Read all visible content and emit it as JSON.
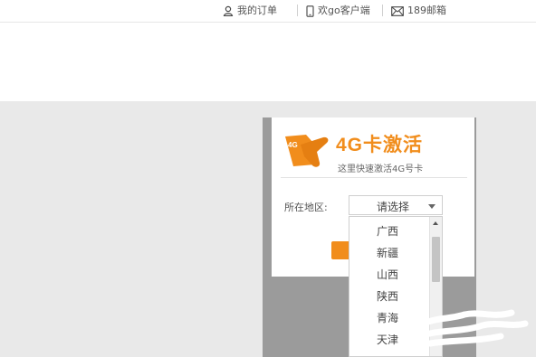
{
  "header": {
    "links": [
      {
        "icon": "user-icon",
        "label": "我的订单"
      },
      {
        "icon": "phone-icon",
        "label": "欢go客户端"
      },
      {
        "icon": "mail-icon",
        "label": "189邮箱"
      }
    ]
  },
  "activation_card": {
    "title": "4G卡激活",
    "subtitle": "这里快速激活4G号卡",
    "badge": "4G",
    "accent_color": "#f18d1c",
    "region_label": "所在地区:",
    "select": {
      "selected": "请选择",
      "options": [
        "广西",
        "新疆",
        "山西",
        "陕西",
        "青海",
        "天津"
      ]
    }
  }
}
